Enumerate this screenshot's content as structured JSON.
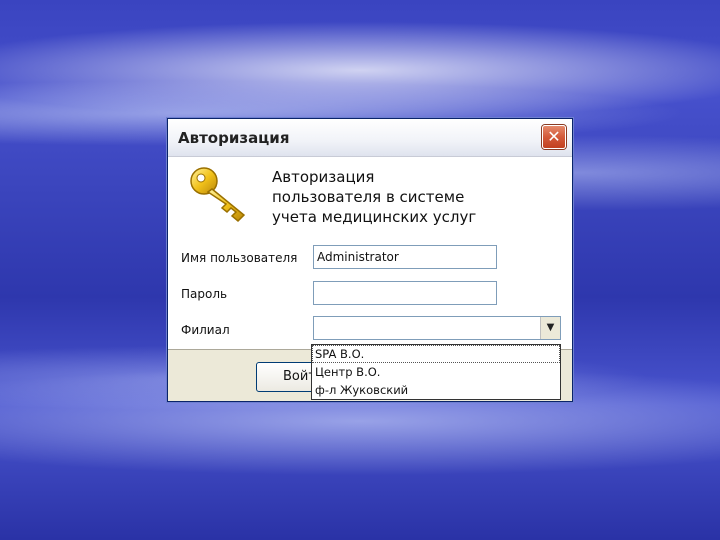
{
  "window": {
    "title": "Авторизация",
    "close_label": "✕",
    "heading_lines": [
      "Авторизация",
      "пользователя в системе",
      "учета медицинских услуг"
    ],
    "icon": "key-icon"
  },
  "form": {
    "username": {
      "label": "Имя пользователя",
      "value": "Administrator"
    },
    "password": {
      "label": "Пароль",
      "value": ""
    },
    "branch": {
      "label": "Филиал",
      "value": ""
    }
  },
  "branch_options": [
    "SPA В.О.",
    "Центр В.О.",
    "ф-л Жуковский"
  ],
  "buttons": {
    "login_label": "Войти"
  },
  "colors": {
    "close_button": "#d35a3a",
    "key": "#f2c21a",
    "desktop": "#3a44c0"
  }
}
